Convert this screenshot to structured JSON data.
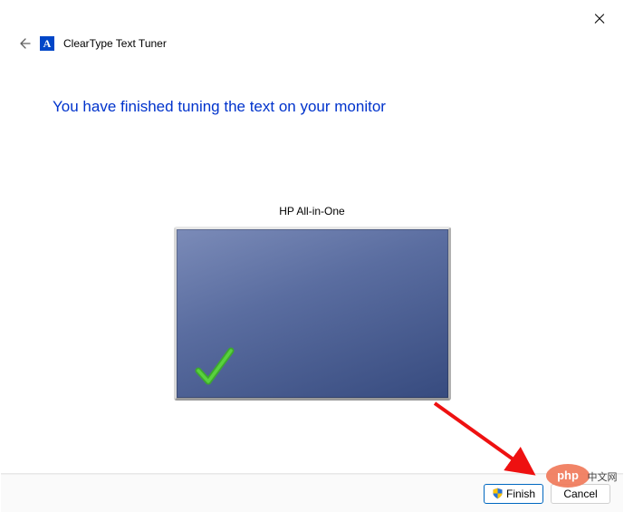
{
  "window": {
    "close_label": "Close"
  },
  "header": {
    "title": "ClearType Text Tuner",
    "app_icon_letter": "A"
  },
  "main": {
    "heading": "You have finished tuning the text on your monitor",
    "monitor_label": "HP All-in-One"
  },
  "footer": {
    "finish_label": "Finish",
    "cancel_label": "Cancel"
  },
  "watermark": {
    "brand": "php",
    "text": "中文网"
  }
}
